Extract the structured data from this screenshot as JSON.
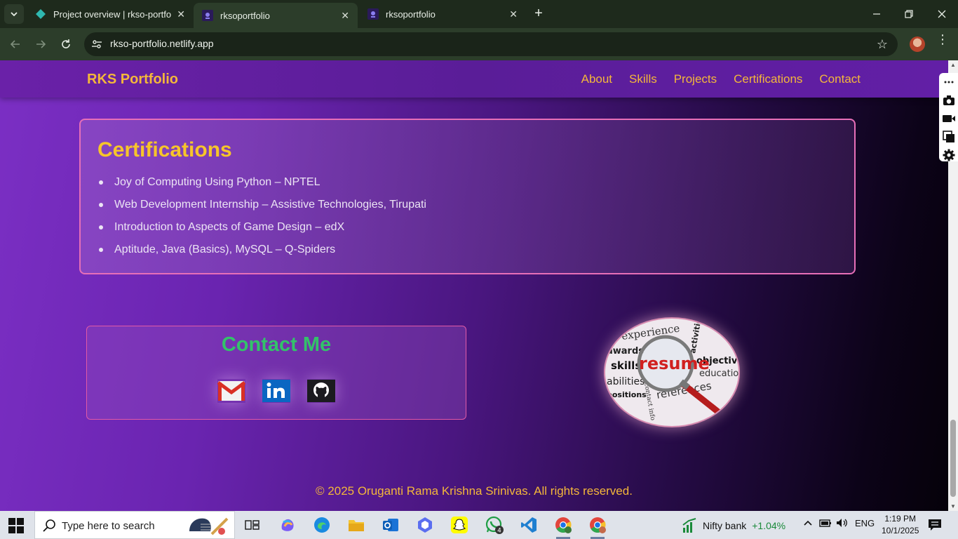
{
  "browser": {
    "tabs": [
      {
        "title": "Project overview | rkso-portfolio",
        "active": false
      },
      {
        "title": "rksoportfolio",
        "active": true
      },
      {
        "title": "rksoportfolio",
        "active": false
      }
    ],
    "url": "rkso-portfolio.netlify.app"
  },
  "site": {
    "brand": "RKS Portfolio",
    "nav": [
      "About",
      "Skills",
      "Projects",
      "Certifications",
      "Contact"
    ],
    "certifications": {
      "title": "Certifications",
      "items": [
        "Joy of Computing Using Python – NPTEL",
        "Web Development Internship – Assistive Technologies, Tirupati",
        "Introduction to Aspects of Game Design – edX",
        "Aptitude, Java (Basics), MySQL – Q-Spiders"
      ]
    },
    "contact": {
      "title": "Contact Me",
      "links": [
        "gmail-icon",
        "linkedin-icon",
        "github-icon"
      ]
    },
    "resume_image_words": [
      "experience",
      "awards",
      "skills",
      "resume",
      "activities",
      "objective",
      "education",
      "abilities",
      "positions",
      "contact info",
      "references"
    ],
    "footer": "© 2025 Oruganti Rama Krishna Srinivas. All rights reserved."
  },
  "taskbar": {
    "search_placeholder": "Type here to search",
    "whatsapp_badge": "4",
    "ticker_name": "Nifty bank",
    "ticker_change": "+1.04%",
    "language": "ENG",
    "time": "1:19 PM",
    "date": "10/1/2025"
  },
  "colors": {
    "accent_gold": "#f4b73a",
    "cert_title": "#f7c52a",
    "contact_green": "#33c26a",
    "card_border_pink": "#e76fb8"
  }
}
